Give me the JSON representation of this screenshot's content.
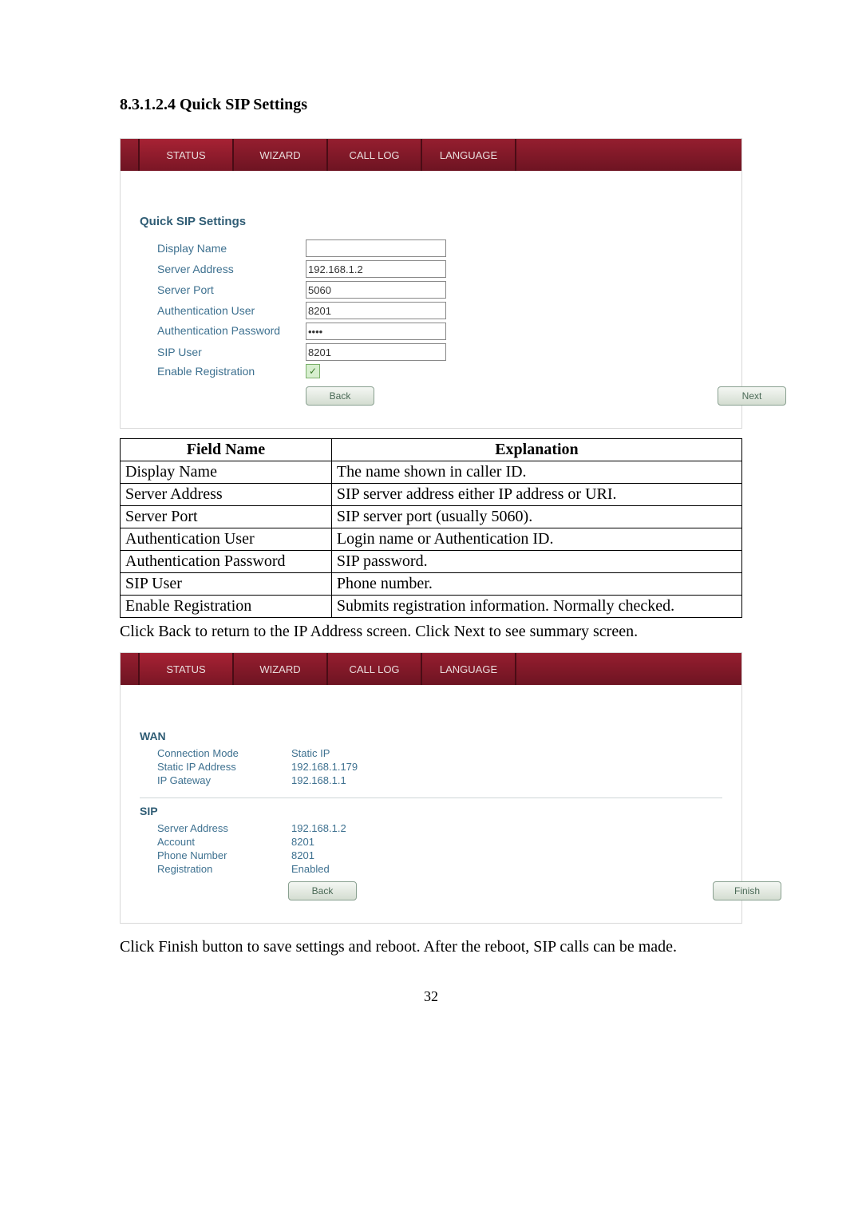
{
  "page_number": "32",
  "heading": "8.3.1.2.4   Quick SIP Settings",
  "tabs": {
    "status": "STATUS",
    "wizard": "WIZARD",
    "calllog": "CALL LOG",
    "language": "LANGUAGE"
  },
  "sip_form": {
    "title": "Quick SIP Settings",
    "labels": {
      "display_name": "Display Name",
      "server_address": "Server Address",
      "server_port": "Server Port",
      "auth_user": "Authentication User",
      "auth_pass": "Authentication Password",
      "sip_user": "SIP User",
      "enable_reg": "Enable Registration"
    },
    "values": {
      "display_name": "",
      "server_address": "192.168.1.2",
      "server_port": "5060",
      "auth_user": "8201",
      "auth_pass": "••••",
      "sip_user": "8201",
      "enable_reg_checked": "✓"
    },
    "buttons": {
      "back": "Back",
      "next": "Next"
    }
  },
  "explain_table": {
    "header": {
      "field": "Field Name",
      "exp": "Explanation"
    },
    "rows": [
      {
        "field": "Display Name",
        "exp": "The name shown in caller ID."
      },
      {
        "field": "Server Address",
        "exp": "SIP server address either IP address or URI."
      },
      {
        "field": "Server Port",
        "exp": "SIP server port (usually 5060)."
      },
      {
        "field": "Authentication User",
        "exp": "Login name or Authentication ID."
      },
      {
        "field": "Authentication Password",
        "exp": "SIP password."
      },
      {
        "field": "SIP User",
        "exp": "Phone number."
      },
      {
        "field": "Enable Registration",
        "exp": "Submits registration information.   Normally checked."
      }
    ]
  },
  "text_after_table": "Click Back to return to the IP Address screen.    Click Next to see summary screen.",
  "summary": {
    "wan": {
      "title": "WAN",
      "rows": [
        {
          "label": "Connection Mode",
          "value": "Static IP"
        },
        {
          "label": "Static IP Address",
          "value": "192.168.1.179"
        },
        {
          "label": "IP Gateway",
          "value": "192.168.1.1"
        }
      ]
    },
    "sip": {
      "title": "SIP",
      "rows": [
        {
          "label": "Server Address",
          "value": "192.168.1.2"
        },
        {
          "label": "Account",
          "value": "8201"
        },
        {
          "label": "Phone Number",
          "value": "8201"
        },
        {
          "label": "Registration",
          "value": "Enabled"
        }
      ]
    },
    "buttons": {
      "back": "Back",
      "finish": "Finish"
    }
  },
  "text_bottom": "Click Finish button to save settings and reboot.    After the reboot, SIP calls can be made."
}
